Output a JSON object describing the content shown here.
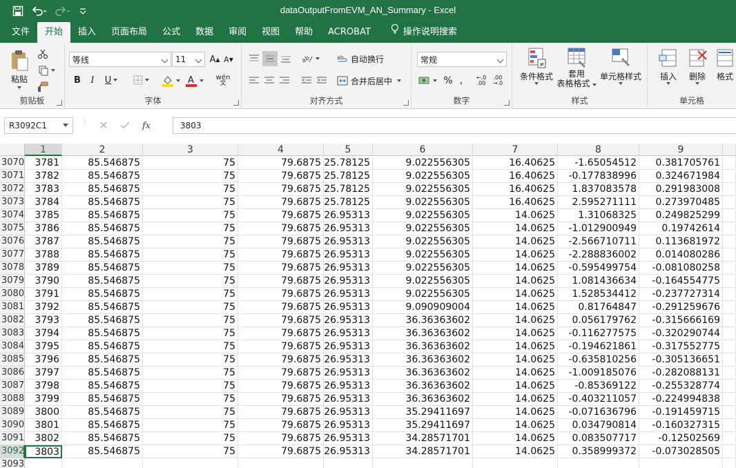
{
  "window": {
    "title": "dataOutputFromEVM_AN_Summary  -  Excel"
  },
  "ribbon_tabs": [
    "文件",
    "开始",
    "插入",
    "页面布局",
    "公式",
    "数据",
    "审阅",
    "视图",
    "帮助",
    "ACROBAT"
  ],
  "tell_me": "操作说明搜索",
  "clipboard": {
    "paste": "粘贴",
    "label": "剪贴板"
  },
  "font": {
    "name": "等线",
    "size": "11",
    "label": "字体"
  },
  "alignment": {
    "wrap": "自动换行",
    "merge": "合并后居中",
    "label": "对齐方式"
  },
  "number": {
    "format": "常规",
    "label": "数字"
  },
  "styles": {
    "conditional": "条件格式",
    "table_line1": "套用",
    "table_line2": "表格格式",
    "cell_styles": "单元格样式",
    "label": "样式"
  },
  "cells": {
    "insert": "插入",
    "delete": "删除",
    "format": "格式",
    "label": "单元格"
  },
  "formula_bar": {
    "name_box": "R3092C1",
    "value": "3803"
  },
  "grid": {
    "columns": [
      "1",
      "2",
      "3",
      "4",
      "5",
      "6",
      "7",
      "8",
      "9"
    ],
    "rows": [
      {
        "num": "3070",
        "cells": [
          "3781",
          "85.546875",
          "75",
          "79.6875",
          "25.78125",
          "9.022556305",
          "16.40625",
          "-1.65054512",
          "0.381705761"
        ]
      },
      {
        "num": "3071",
        "cells": [
          "3782",
          "85.546875",
          "75",
          "79.6875",
          "25.78125",
          "9.022556305",
          "16.40625",
          "-0.177838996",
          "0.324671984"
        ]
      },
      {
        "num": "3072",
        "cells": [
          "3783",
          "85.546875",
          "75",
          "79.6875",
          "25.78125",
          "9.022556305",
          "16.40625",
          "1.837083578",
          "0.291983008"
        ]
      },
      {
        "num": "3073",
        "cells": [
          "3784",
          "85.546875",
          "75",
          "79.6875",
          "25.78125",
          "9.022556305",
          "16.40625",
          "2.595271111",
          "0.273970485"
        ]
      },
      {
        "num": "3074",
        "cells": [
          "3785",
          "85.546875",
          "75",
          "79.6875",
          "26.95313",
          "9.022556305",
          "14.0625",
          "1.31068325",
          "0.249825299"
        ]
      },
      {
        "num": "3075",
        "cells": [
          "3786",
          "85.546875",
          "75",
          "79.6875",
          "26.95313",
          "9.022556305",
          "14.0625",
          "-1.012900949",
          "0.19742614"
        ]
      },
      {
        "num": "3076",
        "cells": [
          "3787",
          "85.546875",
          "75",
          "79.6875",
          "26.95313",
          "9.022556305",
          "14.0625",
          "-2.566710711",
          "0.113681972"
        ]
      },
      {
        "num": "3077",
        "cells": [
          "3788",
          "85.546875",
          "75",
          "79.6875",
          "26.95313",
          "9.022556305",
          "14.0625",
          "-2.288836002",
          "0.014080286"
        ]
      },
      {
        "num": "3078",
        "cells": [
          "3789",
          "85.546875",
          "75",
          "79.6875",
          "26.95313",
          "9.022556305",
          "14.0625",
          "-0.595499754",
          "-0.081080258"
        ]
      },
      {
        "num": "3079",
        "cells": [
          "3790",
          "85.546875",
          "75",
          "79.6875",
          "26.95313",
          "9.022556305",
          "14.0625",
          "1.081436634",
          "-0.164554775"
        ]
      },
      {
        "num": "3080",
        "cells": [
          "3791",
          "85.546875",
          "75",
          "79.6875",
          "26.95313",
          "9.022556305",
          "14.0625",
          "1.528534412",
          "-0.237727314"
        ]
      },
      {
        "num": "3081",
        "cells": [
          "3792",
          "85.546875",
          "75",
          "79.6875",
          "26.95313",
          "9.090909004",
          "14.0625",
          "0.81764847",
          "-0.291259676"
        ]
      },
      {
        "num": "3082",
        "cells": [
          "3793",
          "85.546875",
          "75",
          "79.6875",
          "26.95313",
          "36.36363602",
          "14.0625",
          "0.056179762",
          "-0.315666169"
        ]
      },
      {
        "num": "3083",
        "cells": [
          "3794",
          "85.546875",
          "75",
          "79.6875",
          "26.95313",
          "36.36363602",
          "14.0625",
          "-0.116277575",
          "-0.320290744"
        ]
      },
      {
        "num": "3084",
        "cells": [
          "3795",
          "85.546875",
          "75",
          "79.6875",
          "26.95313",
          "36.36363602",
          "14.0625",
          "-0.194621861",
          "-0.317552775"
        ]
      },
      {
        "num": "3085",
        "cells": [
          "3796",
          "85.546875",
          "75",
          "79.6875",
          "26.95313",
          "36.36363602",
          "14.0625",
          "-0.635810256",
          "-0.305136651"
        ]
      },
      {
        "num": "3086",
        "cells": [
          "3797",
          "85.546875",
          "75",
          "79.6875",
          "26.95313",
          "36.36363602",
          "14.0625",
          "-1.009185076",
          "-0.282088131"
        ]
      },
      {
        "num": "3087",
        "cells": [
          "3798",
          "85.546875",
          "75",
          "79.6875",
          "26.95313",
          "36.36363602",
          "14.0625",
          "-0.85369122",
          "-0.255328774"
        ]
      },
      {
        "num": "3088",
        "cells": [
          "3799",
          "85.546875",
          "75",
          "79.6875",
          "26.95313",
          "36.36363602",
          "14.0625",
          "-0.403211057",
          "-0.224994838"
        ]
      },
      {
        "num": "3089",
        "cells": [
          "3800",
          "85.546875",
          "75",
          "79.6875",
          "26.95313",
          "35.29411697",
          "14.0625",
          "-0.071636796",
          "-0.191459715"
        ]
      },
      {
        "num": "3090",
        "cells": [
          "3801",
          "85.546875",
          "75",
          "79.6875",
          "26.95313",
          "35.29411697",
          "14.0625",
          "0.034790814",
          "-0.160327315"
        ]
      },
      {
        "num": "3091",
        "cells": [
          "3802",
          "85.546875",
          "75",
          "79.6875",
          "26.95313",
          "34.28571701",
          "14.0625",
          "0.083507717",
          "-0.12502569"
        ]
      },
      {
        "num": "3092",
        "cells": [
          "3803",
          "85.546875",
          "75",
          "79.6875",
          "26.95313",
          "34.28571701",
          "14.0625",
          "0.358999372",
          "-0.073028505"
        ]
      },
      {
        "num": "3093",
        "cells": [
          "",
          "",
          "",
          "",
          "",
          "",
          "",
          "",
          ""
        ]
      }
    ]
  },
  "colors": {
    "accent": "#217346",
    "font_color_bar": "#e03030",
    "highlight_bar": "#ffe000"
  },
  "icons": [
    "save-icon",
    "undo-icon",
    "redo-icon",
    "customize-qat-icon",
    "lightbulb-icon",
    "scissors-icon",
    "copy-icon",
    "format-painter-icon",
    "fx-icon",
    "cancel-icon",
    "enter-icon"
  ]
}
